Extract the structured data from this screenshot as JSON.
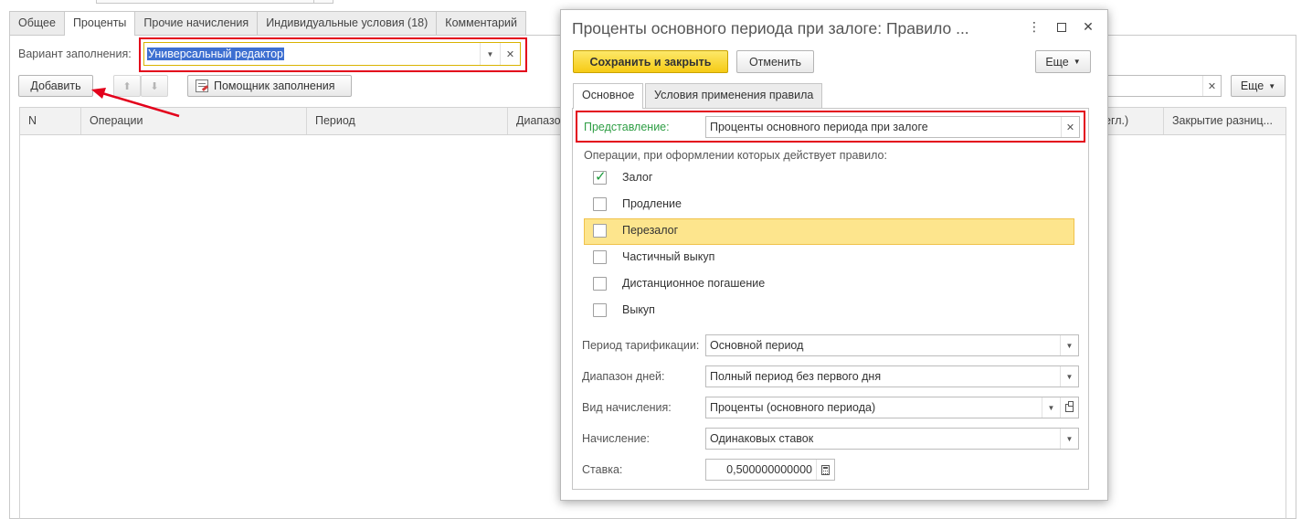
{
  "main": {
    "tabs": [
      {
        "label": "Общее"
      },
      {
        "label": "Проценты"
      },
      {
        "label": "Прочие начисления"
      },
      {
        "label": "Индивидуальные условия (18)"
      },
      {
        "label": "Комментарий"
      }
    ],
    "fill_variant": {
      "label": "Вариант заполнения:",
      "value": "Универсальный редактор"
    },
    "toolbar": {
      "add_label": "Добавить",
      "wizard_label": "Помощник заполнения",
      "more_label": "Еще"
    },
    "grid_columns": [
      "N",
      "Операции",
      "Период",
      "Диапазон",
      "егл.)",
      "Закрытие разниц..."
    ]
  },
  "dialog": {
    "title": "Проценты основного периода при залоге: Правило ...",
    "save_close_label": "Сохранить и закрыть",
    "cancel_label": "Отменить",
    "more_label": "Еще",
    "tabs": [
      {
        "label": "Основное"
      },
      {
        "label": "Условия применения правила"
      }
    ],
    "presentation": {
      "label": "Представление:",
      "value": "Проценты основного периода при залоге"
    },
    "operations_label": "Операции, при оформлении которых действует правило:",
    "operations": [
      {
        "label": "Залог",
        "checked": true
      },
      {
        "label": "Продление",
        "checked": false
      },
      {
        "label": "Перезалог",
        "checked": false
      },
      {
        "label": "Частичный выкуп",
        "checked": false
      },
      {
        "label": "Дистанционное погашение",
        "checked": false
      },
      {
        "label": "Выкуп",
        "checked": false
      }
    ],
    "fields": {
      "tariff_period": {
        "label": "Период тарификации:",
        "value": "Основной период"
      },
      "days_range": {
        "label": "Диапазон дней:",
        "value": "Полный период без первого дня"
      },
      "accrual_type": {
        "label": "Вид начисления:",
        "value": "Проценты (основного периода)"
      },
      "accrual": {
        "label": "Начисление:",
        "value": "Одинаковых ставок"
      },
      "rate": {
        "label": "Ставка:",
        "value": "0,500000000000"
      }
    }
  },
  "colors": {
    "accent_yellow": "#f6cb15",
    "highlight_red": "#e3001b",
    "check_green": "#1a9a3a",
    "presentation_label": "#2e9e44"
  }
}
